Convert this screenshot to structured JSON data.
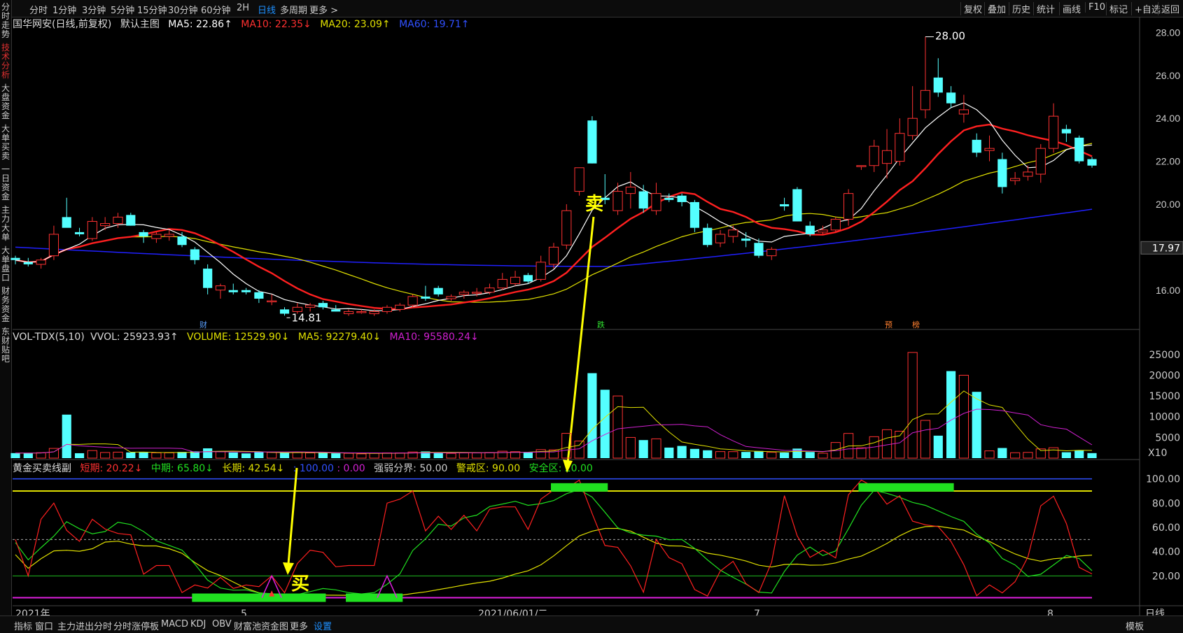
{
  "toolbar": {
    "periods": [
      "分时",
      "1分钟",
      "3分钟",
      "5分钟",
      "15分钟",
      "30分钟",
      "60分钟",
      "2H",
      "日线",
      "多周期",
      "更多 >"
    ],
    "active": "日线",
    "right": [
      "复权",
      "叠加",
      "历史",
      "统计",
      "画线",
      "F10",
      "标记",
      "+自选",
      "返回"
    ]
  },
  "sidebar": [
    "分时走势",
    "技术分析",
    "大盘资金",
    "大单买卖",
    "一日资金",
    "主力大单",
    "大单盘口",
    "财务资金",
    "东财贴吧"
  ],
  "sidebar_active": "技术分析",
  "main": {
    "title": "国华网安(日线,前复权)",
    "template": "默认主图",
    "ma5": "MA5: 22.86↑",
    "ma10": "MA10: 22.35↓",
    "ma20": "MA20: 23.09↑",
    "ma60": "MA60: 19.71↑",
    "high_label": "28.00",
    "low_label": "14.81",
    "current_price": "17.97",
    "yticks": [
      "28.00",
      "26.00",
      "24.00",
      "22.00",
      "20.00",
      "16.00"
    ],
    "sell_mark": "卖",
    "buy_mark": "买",
    "events": [
      "财",
      "跌",
      "预",
      "榜"
    ]
  },
  "volume": {
    "title": "VOL-TDX(5,10)",
    "vvol": "VVOL: 25923.93↑",
    "volume": "VOLUME: 12529.90↓",
    "ma5": "MA5: 92279.40↓",
    "ma10": "MA10: 95580.24↓",
    "yticks": [
      "25000",
      "20000",
      "15000",
      "10000",
      "5000",
      "X10"
    ]
  },
  "indicator": {
    "title": "黄金买卖线副",
    "short": "短期: 20.22↓",
    "mid": "中期: 65.80↓",
    "long": "长期: 42.54↓",
    "v1": ": 100.00",
    "v2": ": 0.00",
    "divide": "强弱分界: 50.00",
    "alert": "警戒区: 90.00",
    "safe": "安全区: 20.00",
    "yticks": [
      "100.00",
      "80.00",
      "60.00",
      "40.00",
      "20.00"
    ]
  },
  "xaxis": [
    "2021年",
    "5",
    "2021/06/01/二",
    "7",
    "8",
    "日线"
  ],
  "bottombar": [
    "指标",
    "窗口",
    "主力进出分时",
    "分时涨停板",
    "MACD",
    "KDJ",
    "OBV",
    "财富池资金图",
    "更多",
    "设置"
  ],
  "bottombar_active": "设置",
  "bottom_right": "模板",
  "colors": {
    "up": "#ff3232",
    "down": "#54ffff",
    "ma5": "#ffffff",
    "ma10": "#ff2020",
    "ma20": "#e0e000",
    "ma60": "#2020ff"
  },
  "chart_data": {
    "type": "candlestick",
    "candles": [
      [
        17.5,
        17.6,
        17.2,
        17.4
      ],
      [
        17.3,
        17.5,
        17.1,
        17.2
      ],
      [
        17.2,
        17.5,
        17.0,
        17.4
      ],
      [
        17.6,
        19.0,
        17.4,
        18.6
      ],
      [
        19.4,
        20.3,
        19.0,
        18.9
      ],
      [
        18.7,
        18.9,
        18.5,
        18.6
      ],
      [
        18.4,
        19.4,
        18.3,
        19.2
      ],
      [
        19.0,
        19.4,
        18.8,
        19.1
      ],
      [
        19.1,
        19.6,
        18.9,
        19.4
      ],
      [
        19.5,
        19.6,
        19.0,
        19.0
      ],
      [
        18.7,
        18.8,
        18.2,
        18.5
      ],
      [
        18.4,
        18.7,
        18.2,
        18.6
      ],
      [
        18.5,
        18.8,
        18.3,
        18.6
      ],
      [
        18.5,
        18.7,
        18.0,
        18.1
      ],
      [
        17.9,
        18.0,
        17.2,
        17.4
      ],
      [
        17.0,
        17.2,
        15.8,
        16.1
      ],
      [
        16.0,
        16.3,
        15.6,
        16.2
      ],
      [
        16.0,
        16.3,
        15.8,
        15.9
      ],
      [
        16.0,
        16.1,
        15.8,
        15.9
      ],
      [
        15.9,
        16.0,
        15.4,
        15.6
      ],
      [
        15.5,
        15.8,
        15.3,
        15.5
      ],
      [
        15.1,
        15.2,
        14.81,
        14.9
      ],
      [
        15.0,
        15.4,
        14.9,
        15.2
      ],
      [
        15.2,
        15.4,
        15.0,
        15.3
      ],
      [
        15.4,
        15.5,
        15.1,
        15.2
      ],
      [
        15.1,
        15.3,
        15.0,
        15.0
      ],
      [
        14.9,
        15.1,
        14.8,
        15.0
      ],
      [
        15.0,
        15.1,
        14.9,
        15.0
      ],
      [
        14.9,
        15.1,
        14.8,
        15.0
      ],
      [
        15.0,
        15.3,
        14.9,
        15.2
      ],
      [
        15.1,
        15.4,
        15.0,
        15.3
      ],
      [
        15.3,
        15.8,
        15.2,
        15.7
      ],
      [
        15.7,
        16.2,
        15.5,
        15.6
      ],
      [
        16.1,
        16.2,
        15.7,
        15.8
      ],
      [
        15.6,
        15.8,
        15.5,
        15.7
      ],
      [
        15.8,
        16.0,
        15.6,
        15.9
      ],
      [
        15.9,
        16.1,
        15.7,
        15.9
      ],
      [
        15.9,
        16.3,
        15.8,
        16.1
      ],
      [
        16.1,
        16.8,
        16.0,
        16.5
      ],
      [
        16.3,
        16.9,
        16.2,
        16.6
      ],
      [
        16.7,
        16.8,
        16.3,
        16.4
      ],
      [
        16.5,
        17.6,
        16.4,
        17.3
      ],
      [
        17.2,
        18.2,
        17.0,
        18.0
      ],
      [
        18.1,
        20.0,
        17.9,
        19.7
      ],
      [
        20.6,
        21.7,
        20.4,
        21.7
      ],
      [
        23.9,
        24.1,
        21.9,
        21.9
      ],
      [
        20.3,
        21.4,
        20.0,
        20.2
      ],
      [
        19.7,
        21.0,
        19.5,
        20.6
      ],
      [
        20.5,
        21.5,
        19.8,
        20.8
      ],
      [
        20.6,
        20.9,
        19.6,
        19.8
      ],
      [
        19.7,
        21.0,
        19.5,
        20.5
      ],
      [
        20.3,
        20.5,
        20.1,
        20.2
      ],
      [
        20.4,
        20.5,
        19.9,
        20.1
      ],
      [
        20.1,
        20.2,
        18.7,
        18.9
      ],
      [
        18.9,
        19.1,
        18.0,
        18.1
      ],
      [
        18.2,
        18.8,
        18.0,
        18.6
      ],
      [
        18.5,
        19.0,
        18.2,
        18.8
      ],
      [
        18.4,
        18.7,
        18.0,
        18.3
      ],
      [
        18.2,
        18.4,
        17.5,
        17.6
      ],
      [
        17.6,
        18.0,
        17.4,
        17.9
      ],
      [
        20.0,
        20.3,
        19.7,
        19.9
      ],
      [
        20.7,
        20.8,
        19.2,
        19.2
      ],
      [
        19.0,
        19.2,
        18.5,
        18.6
      ],
      [
        18.7,
        19.0,
        18.6,
        18.8
      ],
      [
        18.8,
        19.4,
        18.7,
        19.3
      ],
      [
        19.3,
        20.7,
        19.0,
        20.5
      ],
      [
        21.8,
        21.8,
        21.6,
        21.8
      ],
      [
        21.8,
        23.0,
        21.5,
        22.7
      ],
      [
        21.9,
        23.5,
        21.2,
        22.5
      ],
      [
        22.0,
        24.0,
        21.8,
        23.3
      ],
      [
        23.2,
        25.5,
        23.0,
        24.0
      ],
      [
        24.4,
        27.8,
        24.0,
        25.3
      ],
      [
        25.9,
        26.8,
        25.0,
        25.2
      ],
      [
        25.2,
        25.5,
        24.5,
        24.7
      ],
      [
        24.2,
        25.1,
        23.8,
        24.4
      ],
      [
        23.0,
        23.3,
        22.2,
        22.4
      ],
      [
        22.5,
        23.2,
        22.0,
        22.6
      ],
      [
        22.1,
        22.4,
        20.5,
        20.8
      ],
      [
        21.1,
        21.5,
        20.9,
        21.2
      ],
      [
        21.3,
        21.8,
        21.1,
        21.5
      ],
      [
        21.4,
        22.8,
        21.0,
        22.6
      ],
      [
        22.6,
        24.7,
        22.4,
        24.1
      ],
      [
        23.5,
        23.7,
        22.9,
        23.3
      ],
      [
        23.1,
        23.2,
        21.9,
        22.0
      ],
      [
        22.1,
        22.2,
        21.7,
        21.8
      ]
    ]
  }
}
